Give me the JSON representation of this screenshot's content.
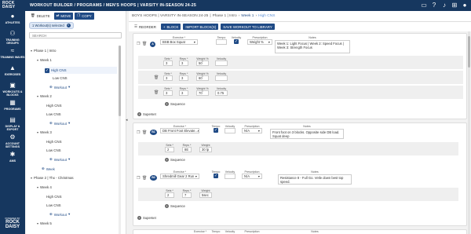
{
  "header": {
    "brand": "ROCK DAISY",
    "title": "WORKOUT BUILDER / PROGRAMS / MEN'S HOOPS | VARSITY IN-SEASON 24-25",
    "icons": [
      "monitor-icon",
      "help-icon",
      "bell-icon",
      "apps-grid-icon",
      "user-icon"
    ]
  },
  "sidebar": {
    "items": [
      {
        "label": "ATHLETES",
        "icon": "athletes-icon"
      },
      {
        "label": "TRAINING GROUPS",
        "icon": "groups-icon"
      },
      {
        "label": "TRAINING WAVES",
        "icon": "waves-icon"
      },
      {
        "label": "EXERCISES",
        "icon": "exercises-icon"
      },
      {
        "label": "WORKOUTS & BLOCKS",
        "icon": "workouts-icon"
      },
      {
        "label": "PROGRAMS",
        "icon": "programs-icon"
      },
      {
        "label": "DISPLAY & EXPORT",
        "icon": "display-icon"
      },
      {
        "label": "ACCOUNT SETTINGS",
        "icon": "settings-icon"
      },
      {
        "label": "AMS",
        "icon": "ams-icon"
      }
    ],
    "powered_by": "POWERED BY",
    "logo_text_1": "ROCK",
    "logo_text_2": "DAISY"
  },
  "leftpanel": {
    "toolbar": {
      "delete": "DELETE",
      "move": "MOVE",
      "copy": "COPY"
    },
    "chip": "1 Workout(s) selected",
    "search_placeholder": "SEARCH",
    "tree": {
      "phase1": "Phase 1 | Intro",
      "week1": "Week 1",
      "high_cns": "High CNS",
      "low_cns": "Low CNS",
      "add_workout": "Workout",
      "week2": "Week 2",
      "week3": "Week 3",
      "add_week": "Week",
      "phase2": "Phase 2 | Thx - Christmas",
      "week4": "Week 4",
      "week5": "Week 5"
    }
  },
  "main": {
    "breadcrumb": {
      "base": "BOYS HOOPS | VARSITY IN-SEASON 24-25",
      "phase": "Phase 1 | Intro",
      "week": "Week 1",
      "workout": "High CNS"
    },
    "toolbar": {
      "reorder": "REORDER",
      "block": "BLOCK",
      "import": "IMPORT BLOCK(S)",
      "save": "SAVE WORKOUT TO LIBRARY"
    },
    "labels": {
      "exercise": "Exercise *",
      "tempo": "Tempo",
      "velocity": "Velocity",
      "prescription": "Prescription",
      "notes": "Notes",
      "sets": "Sets *",
      "reps": "Reps *",
      "weight_pct": "Weight % *",
      "weight": "Weight",
      "superset": "Superset",
      "sequence": "Sequence"
    },
    "block_a": {
      "badge": "A",
      "exercise": "BSB Box Squat",
      "prescription": "Weight %",
      "notes": "Week 1: Light Focus | Week 2: Speed Focus | Week 3: Strength Focus",
      "sets_rows": [
        {
          "sets": "3",
          "reps": "3",
          "weight": "50",
          "velocity": ""
        },
        {
          "sets": "3",
          "reps": "3",
          "weight": "60",
          "velocity": ""
        },
        {
          "sets": "3",
          "reps": "3",
          "weight": "70",
          "velocity": "0.75"
        }
      ]
    },
    "block_b1": {
      "badge": "B1",
      "exercise": "DB Front Foot Elevate...",
      "prescription": "N/A",
      "notes": "Front foot on 3 blocks. Opposite side DB load. Squat deep",
      "sets": "2",
      "reps": "8E",
      "weight": "30 lp"
    },
    "block_b2": {
      "badge": "B2",
      "exercise": "Shredmill Gear 2 Run",
      "prescription": "N/A",
      "notes": "Resistance 8 - Full Go. Vetle down best top speed.",
      "sets": "2",
      "reps": "7",
      "weight": "5sec"
    }
  }
}
